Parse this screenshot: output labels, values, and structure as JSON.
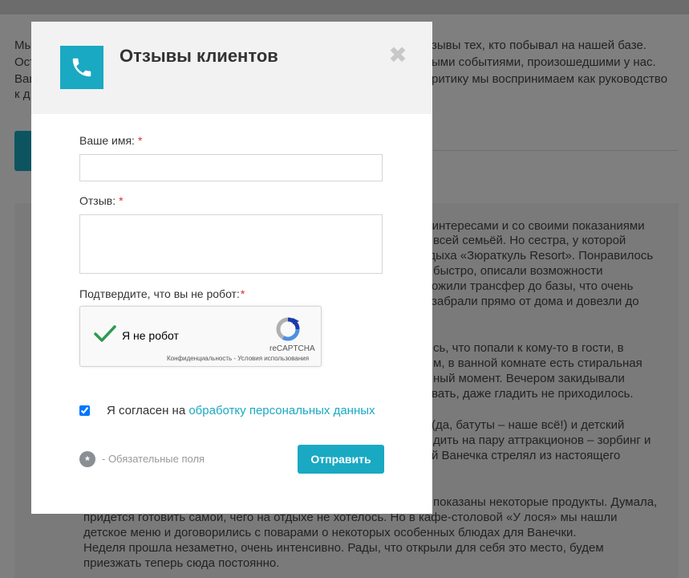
{
  "background": {
    "intro_lines": [
      "Мы",
      "Ост",
      "Ваш",
      "к д"
    ],
    "intro_right": [
      "зывы тех, кто побывал на нашей базе.",
      "ыми событиями, произошедшими у нас.",
      "ритику мы воспринимаем как руководство"
    ],
    "review_lines": [
      "м, интересами и со своими показаниями",
      "всей семьёй. Но сестра, у которой",
      "отдыха «Зюраткуль Resort». Понравилось",
      "быстро, описали возможности",
      "ожили трансфер до базы, что очень",
      "забрали прямо от дома и довезли до",
      "сь, что попали к кому-то в гости, в",
      "м, в ванной комнате есть стиральная",
      "ный момент. Вечером закидывали",
      "вать, даже гладить не приходилось.",
      "(да, батуты – наше всё!) и детский",
      "дить на пару аттракционов – зорбинг и",
      "й Ванечка стрелял из настоящего",
      "показаны некоторые продукты. Думала,",
      "придется готовить самой, чего на отдыхе не хотелось. Но в кафе-столовой «У лося» мы нашли",
      "детское меню и договорились с поварами о некоторых особенных блюдах для Ванечки.",
      "Неделя прошла незаметно, очень интенсивно. Рады, что открыли для себя это место, будем",
      "приезжать теперь сюда постоянно."
    ]
  },
  "modal": {
    "title": "Отзывы клиентов",
    "close_symbol": "✖",
    "icon": "phone-icon",
    "fields": {
      "name_label": "Ваше имя:",
      "name_value": "",
      "review_label": "Отзыв:",
      "review_value": "",
      "captcha_label": "Подтвердите, что вы не робот:",
      "required_mark": "*"
    },
    "recaptcha": {
      "text": "Я не робот",
      "brand": "reCAPTCHA",
      "links": "Конфиденциальность - Условия использования",
      "checked": true
    },
    "agree": {
      "text": "Я согласен на",
      "link": "обработку персональных данных",
      "checked": true
    },
    "required_note": "- Обязательные поля",
    "submit_label": "Отправить"
  },
  "colors": {
    "accent": "#1aa9c2",
    "required": "#d9302c",
    "overlay": "rgba(0,0,0,0.5)"
  }
}
